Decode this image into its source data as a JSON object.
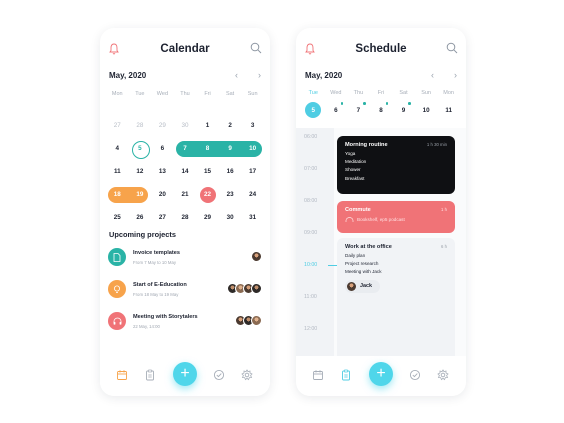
{
  "calendar": {
    "title": "Calendar",
    "month": "May, 2020",
    "weekdays": [
      "Mon",
      "Tue",
      "Wed",
      "Thu",
      "Fri",
      "Sat",
      "Sun"
    ],
    "weeks": [
      [
        "27",
        "28",
        "29",
        "30",
        "1",
        "2",
        "3"
      ],
      [
        "4",
        "5",
        "6",
        "7",
        "8",
        "9",
        "10"
      ],
      [
        "11",
        "12",
        "13",
        "14",
        "15",
        "16",
        "17"
      ],
      [
        "18",
        "19",
        "20",
        "21",
        "22",
        "23",
        "24"
      ],
      [
        "25",
        "26",
        "27",
        "28",
        "29",
        "30",
        "31"
      ]
    ],
    "upcoming_title": "Upcoming projects",
    "projects": [
      {
        "name": "Invoice templates",
        "date": "From 7 May to 10 May",
        "color": "#2ab3a6",
        "icon": "document-icon"
      },
      {
        "name": "Start of E-Education",
        "date": "From 18 May to 19 May",
        "color": "#f7a34b",
        "icon": "lightbulb-icon"
      },
      {
        "name": "Meeting with Storytalers",
        "date": "22 May, 14:00",
        "color": "#f07377",
        "icon": "headphones-icon"
      }
    ]
  },
  "schedule": {
    "title": "Schedule",
    "month": "May, 2020",
    "weekdays": [
      "Tue",
      "Wed",
      "Thu",
      "Fri",
      "Sat",
      "Sun",
      "Mon"
    ],
    "days": [
      "5",
      "6",
      "7",
      "8",
      "9",
      "10",
      "11"
    ],
    "times": [
      "06:00",
      "07:00",
      "08:00",
      "09:00",
      "10:00",
      "11:00",
      "12:00"
    ],
    "events": [
      {
        "title": "Morning routine",
        "duration": "1 h 30 min",
        "items": [
          "Yoga",
          "Meditation",
          "Shower",
          "Breakfast"
        ],
        "bg": "#0f1013",
        "fg": "#ffffff"
      },
      {
        "title": "Commute",
        "duration": "1 h",
        "items": [
          "Bookshelf, ep5 podcast"
        ],
        "bg": "#f07377",
        "fg": "#ffffff"
      },
      {
        "title": "Work at the office",
        "duration": "6 h",
        "items": [
          "Daily plan",
          "Project research",
          "Meeting with Jack"
        ],
        "bg": "#f1f3f6",
        "fg": "#1d2230",
        "person": "Jack"
      }
    ]
  },
  "colors": {
    "accent": "#4fcde3",
    "teal": "#2ab3a6",
    "orange": "#f7a34b",
    "coral": "#f07377"
  }
}
